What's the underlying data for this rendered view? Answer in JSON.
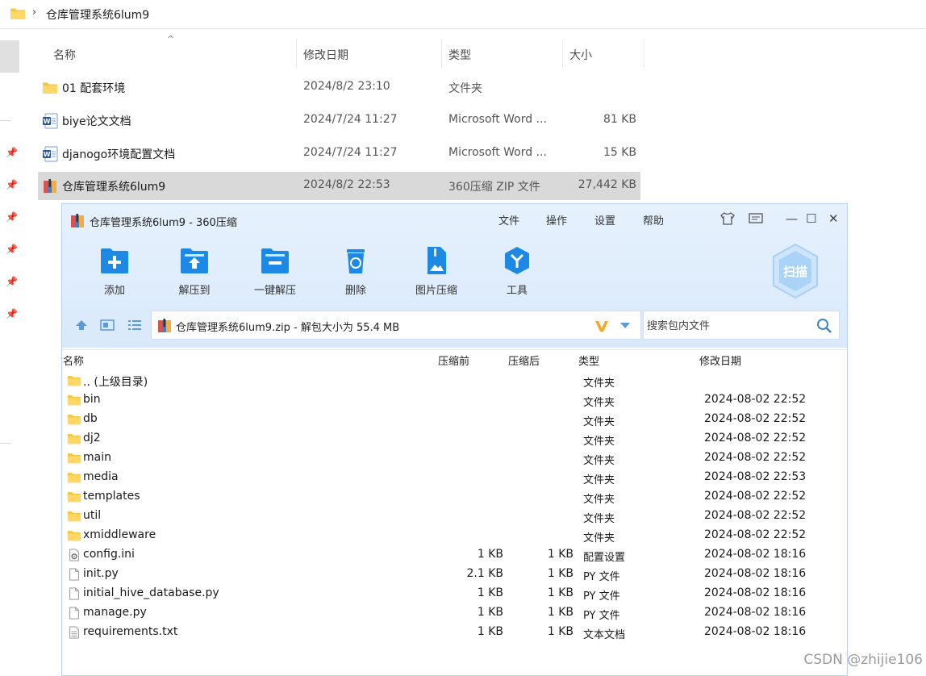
{
  "explorer": {
    "breadcrumb": "仓库管理系统6lum9",
    "columns": {
      "name": "名称",
      "modified": "修改日期",
      "type": "类型",
      "size": "大小"
    },
    "files": [
      {
        "name": "01 配套环境",
        "modified": "2024/8/2 23:10",
        "type": "文件夹",
        "size": "",
        "icon": "folder-icon"
      },
      {
        "name": "biye论文文档",
        "modified": "2024/7/24 11:27",
        "type": "Microsoft Word ...",
        "size": "81 KB",
        "icon": "word-doc-icon"
      },
      {
        "name": "djanogo环境配置文档",
        "modified": "2024/7/24 11:27",
        "type": "Microsoft Word ...",
        "size": "15 KB",
        "icon": "word-doc-icon"
      },
      {
        "name": "仓库管理系统6lum9",
        "modified": "2024/8/2 22:53",
        "type": "360压缩 ZIP 文件",
        "size": "27,442 KB",
        "icon": "zip-archive-icon",
        "selected": true
      }
    ]
  },
  "zip": {
    "title": "仓库管理系统6lum9 - 360压缩",
    "menu": [
      "文件",
      "操作",
      "设置",
      "帮助"
    ],
    "toolbar": [
      {
        "label": "添加",
        "icon": "add-icon"
      },
      {
        "label": "解压到",
        "icon": "extract-to-icon"
      },
      {
        "label": "一键解压",
        "icon": "one-click-extract-icon"
      },
      {
        "label": "删除",
        "icon": "delete-icon"
      },
      {
        "label": "图片压缩",
        "icon": "image-compress-icon"
      },
      {
        "label": "工具",
        "icon": "tools-icon"
      }
    ],
    "scan_label": "扫描",
    "path": "仓库管理系统6lum9.zip - 解包大小为 55.4 MB",
    "search_placeholder": "搜索包内文件",
    "columns": {
      "name": "名称",
      "before": "压缩前",
      "after": "压缩后",
      "type": "类型",
      "modified": "修改日期"
    },
    "rows": [
      {
        "name": ".. (上级目录)",
        "before": "",
        "after": "",
        "type": "文件夹",
        "modified": "",
        "icon": "folder-icon"
      },
      {
        "name": "bin",
        "before": "",
        "after": "",
        "type": "文件夹",
        "modified": "2024-08-02 22:52",
        "icon": "folder-icon"
      },
      {
        "name": "db",
        "before": "",
        "after": "",
        "type": "文件夹",
        "modified": "2024-08-02 22:52",
        "icon": "folder-icon"
      },
      {
        "name": "dj2",
        "before": "",
        "after": "",
        "type": "文件夹",
        "modified": "2024-08-02 22:52",
        "icon": "folder-icon"
      },
      {
        "name": "main",
        "before": "",
        "after": "",
        "type": "文件夹",
        "modified": "2024-08-02 22:52",
        "icon": "folder-icon"
      },
      {
        "name": "media",
        "before": "",
        "after": "",
        "type": "文件夹",
        "modified": "2024-08-02 22:53",
        "icon": "folder-icon"
      },
      {
        "name": "templates",
        "before": "",
        "after": "",
        "type": "文件夹",
        "modified": "2024-08-02 22:52",
        "icon": "folder-icon"
      },
      {
        "name": "util",
        "before": "",
        "after": "",
        "type": "文件夹",
        "modified": "2024-08-02 22:52",
        "icon": "folder-icon"
      },
      {
        "name": "xmiddleware",
        "before": "",
        "after": "",
        "type": "文件夹",
        "modified": "2024-08-02 22:52",
        "icon": "folder-icon"
      },
      {
        "name": "config.ini",
        "before": "1 KB",
        "after": "1 KB",
        "type": "配置设置",
        "modified": "2024-08-02 18:16",
        "icon": "config-file-icon"
      },
      {
        "name": "init.py",
        "before": "2.1 KB",
        "after": "1 KB",
        "type": "PY 文件",
        "modified": "2024-08-02 18:16",
        "icon": "file-icon"
      },
      {
        "name": "initial_hive_database.py",
        "before": "1 KB",
        "after": "1 KB",
        "type": "PY 文件",
        "modified": "2024-08-02 18:16",
        "icon": "file-icon"
      },
      {
        "name": "manage.py",
        "before": "1 KB",
        "after": "1 KB",
        "type": "PY 文件",
        "modified": "2024-08-02 18:16",
        "icon": "file-icon"
      },
      {
        "name": "requirements.txt",
        "before": "1 KB",
        "after": "1 KB",
        "type": "文本文档",
        "modified": "2024-08-02 18:16",
        "icon": "text-file-icon"
      }
    ]
  },
  "watermark": "CSDN @zhijie106"
}
